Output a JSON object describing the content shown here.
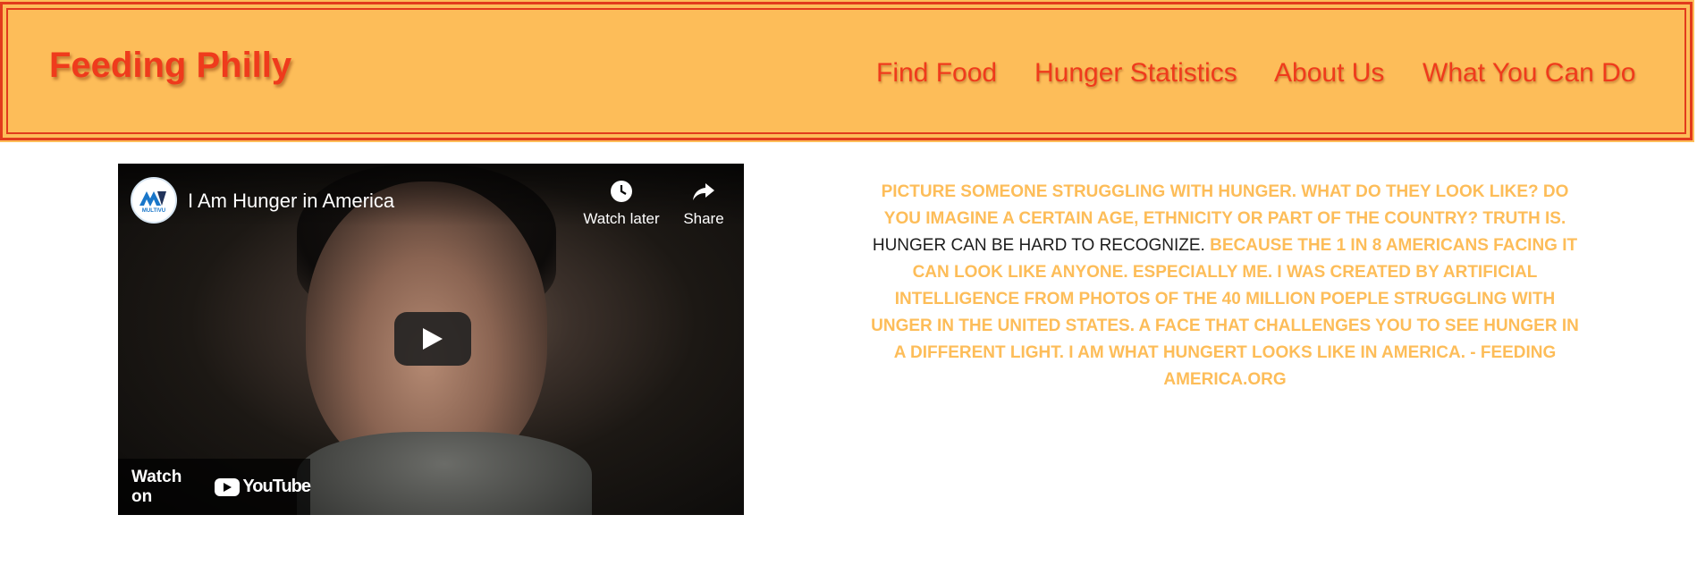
{
  "header": {
    "brand": "Feeding Philly",
    "nav": [
      "Find Food",
      "Hunger Statistics",
      "About Us",
      "What You Can Do"
    ]
  },
  "video": {
    "title": "I Am Hunger in America",
    "channel_logo_text": "MULTIVU",
    "watch_later": "Watch later",
    "share": "Share",
    "watch_on": "Watch on",
    "youtube": "YouTube"
  },
  "quote": {
    "part1": "PICTURE SOMEONE STRUGGLING WITH HUNGER. WHAT DO THEY LOOK LIKE? DO YOU IMAGINE A CERTAIN AGE, ETHNICITY OR PART OF THE COUNTRY? TRUTH IS.",
    "highlight": "HUNGER CAN BE HARD TO RECOGNIZE.",
    "part2": "BECAUSE THE 1 IN 8 AMERICANS FACING IT CAN LOOK LIKE ANYONE. ESPECIALLY ME. I WAS CREATED BY ARTIFICIAL INTELLIGENCE FROM PHOTOS OF THE 40 MILLION POEPLE STRUGGLING WITH UNGER IN THE UNITED STATES. A FACE THAT CHALLENGES YOU TO SEE HUNGER IN A DIFFERENT LIGHT. I AM WHAT HUNGERT LOOKS LIKE IN AMERICA. - FEEDING AMERICA.ORG"
  },
  "colors": {
    "header_bg": "#fdbd59",
    "accent_red": "#ef3b1c",
    "quote_text": "#fdbd59",
    "quote_highlight": "#1d1d1d"
  }
}
